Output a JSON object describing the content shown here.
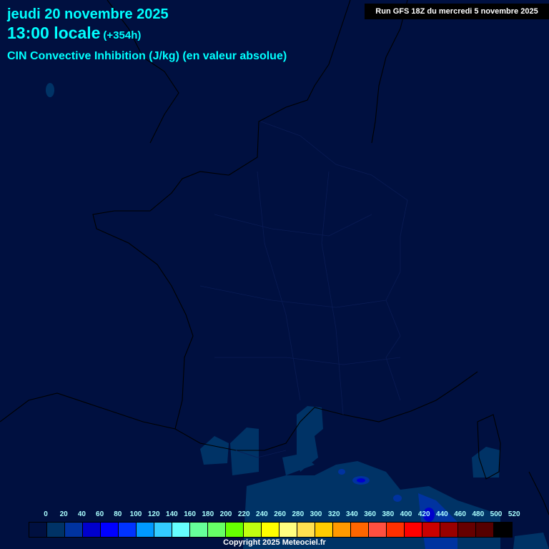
{
  "header": {
    "date": "jeudi 20 novembre 2025",
    "time": "13:00 locale",
    "lead": "(+354h)",
    "parameter": "CIN Convective Inhibition (J/kg) (en valeur absolue)",
    "run": "Run GFS 18Z du mercredi 5 novembre 2025"
  },
  "legend": {
    "labels": [
      "0",
      "20",
      "40",
      "60",
      "80",
      "100",
      "120",
      "140",
      "160",
      "180",
      "200",
      "220",
      "240",
      "260",
      "280",
      "300",
      "320",
      "340",
      "360",
      "380",
      "400",
      "420",
      "440",
      "460",
      "480",
      "500",
      "520"
    ],
    "colors": [
      "#001040",
      "#003366",
      "#0033a0",
      "#0000cc",
      "#0000ff",
      "#0033ff",
      "#0099ff",
      "#33ccff",
      "#66ffff",
      "#66ff99",
      "#66ff66",
      "#66ff00",
      "#c0ff10",
      "#ffff00",
      "#ffff80",
      "#ffe050",
      "#ffcc00",
      "#ff9900",
      "#ff6600",
      "#ff5040",
      "#ff3000",
      "#ff0000",
      "#cc0000",
      "#990000",
      "#660000",
      "#550000",
      "#000000"
    ]
  },
  "footer": {
    "copyright": "Copyright 2025 Meteociel.fr"
  }
}
